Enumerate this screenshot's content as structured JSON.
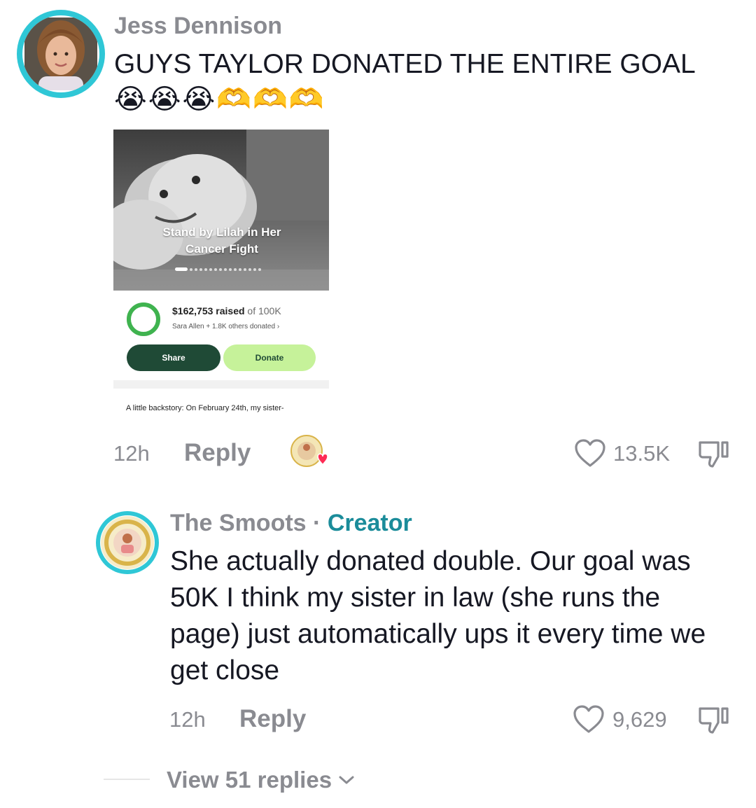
{
  "comments": [
    {
      "username": "Jess Dennison",
      "text": "GUYS TAYLOR DONATED THE ENTIRE GOAL",
      "emojis": "😭😭😭🫶🫶🫶",
      "time": "12h",
      "reply_label": "Reply",
      "likes": "13.5K",
      "attachment": {
        "title": "Stand by Lilah in Her Cancer Fight",
        "raised_amount": "$162,753 raised",
        "goal": "of 100K",
        "donors": "Sara Allen + 1.8K others donated ›",
        "share_label": "Share",
        "donate_label": "Donate",
        "backstory": "A little backstory: On February 24th, my sister-",
        "progress": 1.0,
        "ring_color": "#3fb34f"
      }
    },
    {
      "username": "The Smoots",
      "separator": "·",
      "badge": "Creator",
      "text": "She actually donated double. Our goal was 50K I think my sister in law (she runs the page) just automatically ups it every time we get close",
      "time": "12h",
      "reply_label": "Reply",
      "likes": "9,629"
    }
  ],
  "view_replies": "View 51 replies",
  "colors": {
    "avatar_ring": "#2fc7d6",
    "creator_badge": "#1b8c9a",
    "muted_text": "#8a8b91"
  },
  "icons": [
    "heart-outline-icon",
    "dislike-icon",
    "chevron-down-icon",
    "creator-liked-badge-icon"
  ]
}
